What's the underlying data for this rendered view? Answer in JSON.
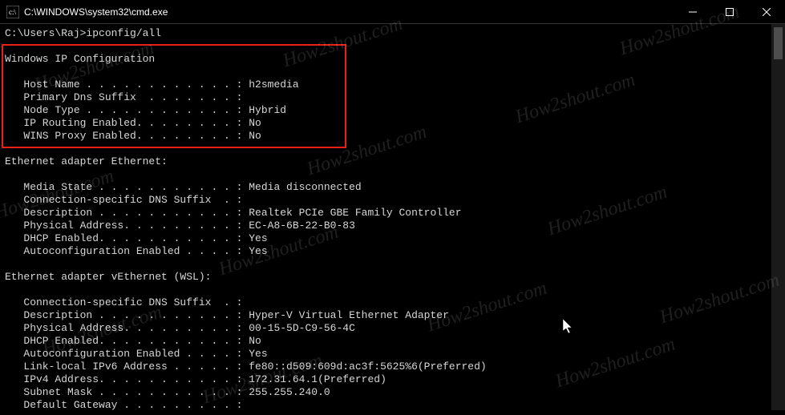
{
  "titlebar": {
    "title": "C:\\WINDOWS\\system32\\cmd.exe"
  },
  "prompt": {
    "path": "C:\\Users\\Raj>",
    "command": "ipconfig/all"
  },
  "sections": {
    "ipconfig_header": "Windows IP Configuration",
    "ipconfig": [
      {
        "label": "   Host Name . . . . . . . . . . . . : ",
        "value": "h2smedia"
      },
      {
        "label": "   Primary Dns Suffix  . . . . . . . : ",
        "value": ""
      },
      {
        "label": "   Node Type . . . . . . . . . . . . : ",
        "value": "Hybrid"
      },
      {
        "label": "   IP Routing Enabled. . . . . . . . : ",
        "value": "No"
      },
      {
        "label": "   WINS Proxy Enabled. . . . . . . . : ",
        "value": "No"
      }
    ],
    "eth_header": "Ethernet adapter Ethernet:",
    "eth": [
      {
        "label": "   Media State . . . . . . . . . . . : ",
        "value": "Media disconnected"
      },
      {
        "label": "   Connection-specific DNS Suffix  . : ",
        "value": ""
      },
      {
        "label": "   Description . . . . . . . . . . . : ",
        "value": "Realtek PCIe GBE Family Controller"
      },
      {
        "label": "   Physical Address. . . . . . . . . : ",
        "value": "EC-A8-6B-22-B0-83"
      },
      {
        "label": "   DHCP Enabled. . . . . . . . . . . : ",
        "value": "Yes"
      },
      {
        "label": "   Autoconfiguration Enabled . . . . : ",
        "value": "Yes"
      }
    ],
    "veth_header": "Ethernet adapter vEthernet (WSL):",
    "veth": [
      {
        "label": "   Connection-specific DNS Suffix  . : ",
        "value": ""
      },
      {
        "label": "   Description . . . . . . . . . . . : ",
        "value": "Hyper-V Virtual Ethernet Adapter"
      },
      {
        "label": "   Physical Address. . . . . . . . . : ",
        "value": "00-15-5D-C9-56-4C"
      },
      {
        "label": "   DHCP Enabled. . . . . . . . . . . : ",
        "value": "No"
      },
      {
        "label": "   Autoconfiguration Enabled . . . . : ",
        "value": "Yes"
      },
      {
        "label": "   Link-local IPv6 Address . . . . . : ",
        "value": "fe80::d509:609d:ac3f:5625%6(Preferred)"
      },
      {
        "label": "   IPv4 Address. . . . . . . . . . . : ",
        "value": "172.31.64.1(Preferred)"
      },
      {
        "label": "   Subnet Mask . . . . . . . . . . . : ",
        "value": "255.255.240.0"
      },
      {
        "label": "   Default Gateway . . . . . . . . . : ",
        "value": ""
      }
    ]
  },
  "watermark_text": "How2shout.com"
}
